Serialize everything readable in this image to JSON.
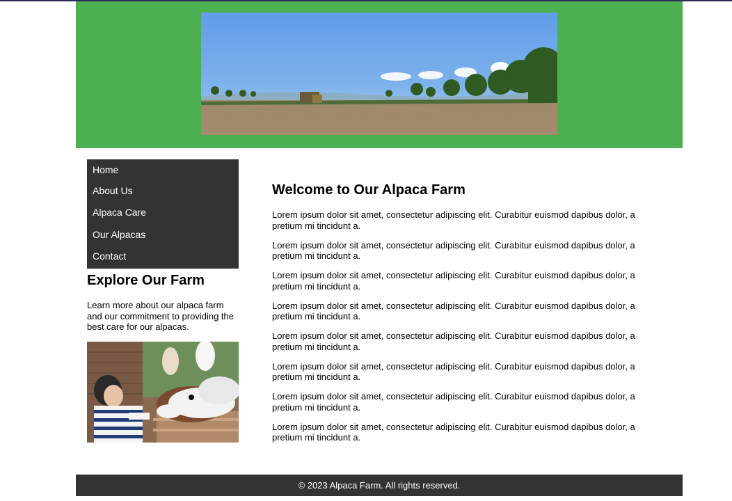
{
  "banner": {
    "image_alt": "farm field landscape"
  },
  "nav": {
    "items": [
      {
        "label": "Home"
      },
      {
        "label": "About Us"
      },
      {
        "label": "Alpaca Care"
      },
      {
        "label": "Our Alpacas"
      },
      {
        "label": "Contact"
      }
    ]
  },
  "sidebar": {
    "heading": "Explore Our Farm",
    "text": "Learn more about our alpaca farm and our commitment to providing the best care for our alpacas.",
    "image_alt": "child feeding alpaca"
  },
  "main": {
    "title": "Welcome to Our Alpaca Farm",
    "paragraphs": [
      "Lorem ipsum dolor sit amet, consectetur adipiscing elit. Curabitur euismod dapibus dolor, a pretium mi tincidunt a.",
      "Lorem ipsum dolor sit amet, consectetur adipiscing elit. Curabitur euismod dapibus dolor, a pretium mi tincidunt a.",
      "Lorem ipsum dolor sit amet, consectetur adipiscing elit. Curabitur euismod dapibus dolor, a pretium mi tincidunt a.",
      "Lorem ipsum dolor sit amet, consectetur adipiscing elit. Curabitur euismod dapibus dolor, a pretium mi tincidunt a.",
      "Lorem ipsum dolor sit amet, consectetur adipiscing elit. Curabitur euismod dapibus dolor, a pretium mi tincidunt a.",
      "Lorem ipsum dolor sit amet, consectetur adipiscing elit. Curabitur euismod dapibus dolor, a pretium mi tincidunt a.",
      "Lorem ipsum dolor sit amet, consectetur adipiscing elit. Curabitur euismod dapibus dolor, a pretium mi tincidunt a.",
      "Lorem ipsum dolor sit amet, consectetur adipiscing elit. Curabitur euismod dapibus dolor, a pretium mi tincidunt a."
    ]
  },
  "footer": {
    "text": "© 2023 Alpaca Farm. All rights reserved."
  },
  "colors": {
    "header_bg": "#4caf50",
    "nav_bg": "#333333",
    "footer_bg": "#333333",
    "top_border": "#2e2a5a"
  }
}
